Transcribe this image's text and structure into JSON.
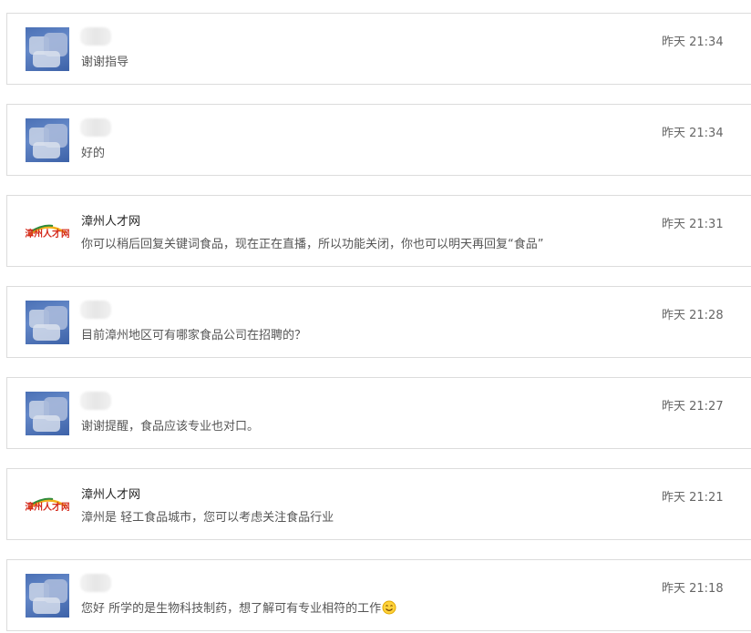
{
  "messages": [
    {
      "type": "user",
      "name": "",
      "text": "谢谢指导",
      "time": "昨天 21:34"
    },
    {
      "type": "user",
      "name": "",
      "text": "好的",
      "time": "昨天 21:34"
    },
    {
      "type": "brand",
      "name": "漳州人才网",
      "text": "你可以稍后回复关键词食品，现在正在直播，所以功能关闭，你也可以明天再回复“食品”",
      "time": "昨天 21:31"
    },
    {
      "type": "user",
      "name": "",
      "text": "目前漳州地区可有哪家食品公司在招聘的？",
      "time": "昨天 21:28"
    },
    {
      "type": "user",
      "name": "",
      "text": "谢谢提醒，食品应该专业也对口。",
      "time": "昨天 21:27"
    },
    {
      "type": "brand",
      "name": "漳州人才网",
      "text": "漳州是 轻工食品城市，您可以考虑关注食品行业",
      "time": "昨天 21:21"
    },
    {
      "type": "user",
      "name": "",
      "text": "您好 所学的是生物科技制药，想了解可有专业相符的工作",
      "time": "昨天 21:18",
      "emoji": "smiley-icon"
    }
  ],
  "brand_logo_text": "漳州人才网",
  "colors": {
    "border": "#dcdcdc",
    "name": "#222222",
    "message": "#555555",
    "time": "#666666",
    "user_avatar": "#4a70b5",
    "logo_red": "#d42a1c",
    "logo_green": "#2e8b3a",
    "logo_yellow": "#f3b21c"
  }
}
